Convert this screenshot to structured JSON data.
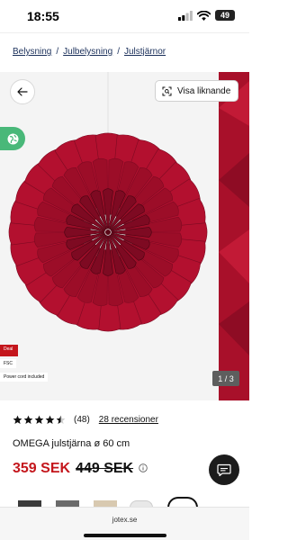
{
  "status_bar": {
    "time": "18:55",
    "battery": "49"
  },
  "breadcrumb": {
    "items": [
      "Belysning",
      "Julbelysning",
      "Julstjärnor"
    ],
    "separator": "/"
  },
  "gallery": {
    "similar_label": "Visa liknande",
    "badges": {
      "deal": "Deal",
      "fsc": "FSC",
      "power": "Power cord included"
    },
    "counter": "1 / 3",
    "colors": {
      "star": "#b3102f",
      "star_dark": "#7e0a22",
      "peek": "#a8102a"
    }
  },
  "product": {
    "rating": 4.5,
    "rating_count": "(48)",
    "reviews_link": "28 recensioner",
    "name": "OMEGA julstjärna ø 60 cm",
    "price_now": "359 SEK",
    "price_old": "449 SEK"
  },
  "icons": {
    "back": "arrow-left-icon",
    "similar": "scan-icon",
    "eco": "globe-leaf-icon",
    "info": "info-icon",
    "chat": "chat-bubble-icon"
  },
  "browser": {
    "url": "jotex.se"
  },
  "colors": {
    "accent_red": "#c4161c",
    "green": "#49b879",
    "navy": "#1a2f5a"
  }
}
